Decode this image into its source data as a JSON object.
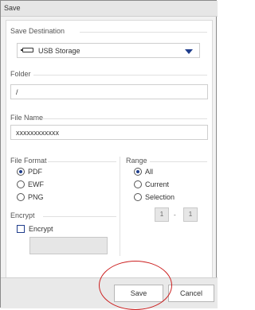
{
  "dialog": {
    "title": "Save"
  },
  "save_destination": {
    "label": "Save Destination",
    "value": "USB Storage",
    "icon": "usb-storage-icon"
  },
  "folder": {
    "label": "Folder",
    "value": "/"
  },
  "file_name": {
    "label": "File Name",
    "value": "xxxxxxxxxxxx"
  },
  "file_format": {
    "label": "File Format",
    "options": [
      {
        "label": "PDF",
        "selected": true
      },
      {
        "label": "EWF",
        "selected": false
      },
      {
        "label": "PNG",
        "selected": false
      }
    ]
  },
  "range": {
    "label": "Range",
    "options": [
      {
        "label": "All",
        "selected": true
      },
      {
        "label": "Current",
        "selected": false
      },
      {
        "label": "Selection",
        "selected": false
      }
    ],
    "from": "1",
    "separator": "-",
    "to": "1"
  },
  "encrypt": {
    "label": "Encrypt",
    "checkbox_label": "Encrypt",
    "checked": false
  },
  "buttons": {
    "save": "Save",
    "cancel": "Cancel"
  },
  "colors": {
    "accent": "#1f3d8c",
    "highlight": "#cc1f1f"
  }
}
